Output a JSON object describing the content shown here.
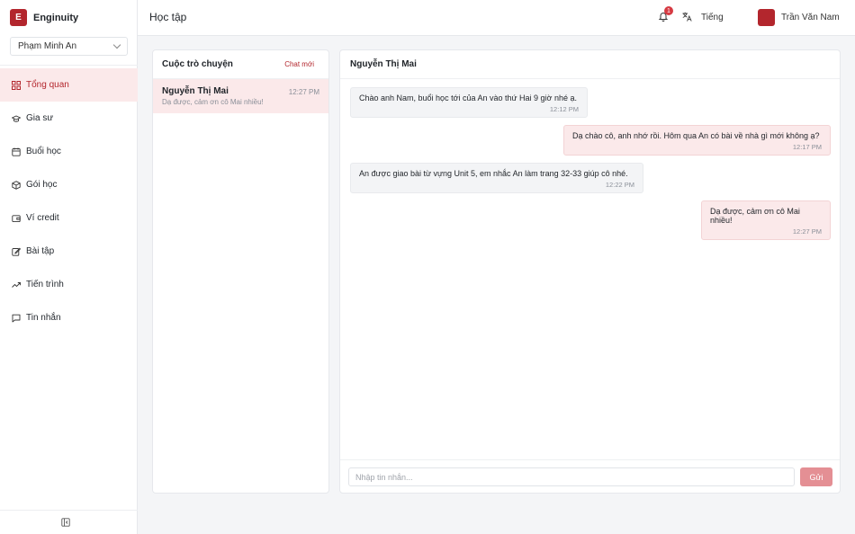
{
  "app": {
    "brand_letter": "E",
    "brand_name": "Enginuity"
  },
  "sidebar": {
    "user_select": "Phạm Minh An",
    "items": [
      {
        "label": "Tổng quan",
        "icon": "grid-icon",
        "active": true
      },
      {
        "label": "Gia sư",
        "icon": "graduation-cap-icon"
      },
      {
        "label": "Buổi học",
        "icon": "calendar-icon"
      },
      {
        "label": "Gói học",
        "icon": "package-icon"
      },
      {
        "label": "Ví credit",
        "icon": "wallet-icon"
      },
      {
        "label": "Bài tập",
        "icon": "edit-icon"
      },
      {
        "label": "Tiến trình",
        "icon": "trending-up-icon"
      },
      {
        "label": "Tin nhắn",
        "icon": "message-icon"
      }
    ]
  },
  "header": {
    "title": "Học tập",
    "notification_count": "1",
    "language_label": "Tiếng",
    "user_name": "Trần Văn Nam"
  },
  "conversations": {
    "title": "Cuộc trò chuyện",
    "new_chat_label": "Chat mới",
    "items": [
      {
        "name": "Nguyễn Thị Mai",
        "time": "12:27 PM",
        "preview": "Dạ được, cảm ơn cô Mai nhiều!"
      }
    ]
  },
  "chat": {
    "title": "Nguyễn Thị Mai",
    "messages": [
      {
        "direction": "in",
        "text": "Chào anh Nam, buổi học tới của An vào thứ Hai 9 giờ nhé ạ.",
        "time": "12:12 PM"
      },
      {
        "direction": "out",
        "text": "Dạ chào cô, anh nhớ rồi. Hôm qua An có bài về nhà gì mới không ạ?",
        "time": "12:17 PM"
      },
      {
        "direction": "in",
        "text": "An được giao bài từ vựng Unit 5, em nhắc An làm trang 32-33 giúp cô nhé.",
        "time": "12:22 PM"
      },
      {
        "direction": "out",
        "text": "Dạ được, cảm ơn cô Mai nhiều!",
        "time": "12:27 PM"
      }
    ],
    "input_placeholder": "Nhập tin nhắn...",
    "send_label": "Gửi"
  },
  "colors": {
    "accent": "#b3262d",
    "accent_soft": "#fbe9ea",
    "send_button": "#e48f94"
  }
}
